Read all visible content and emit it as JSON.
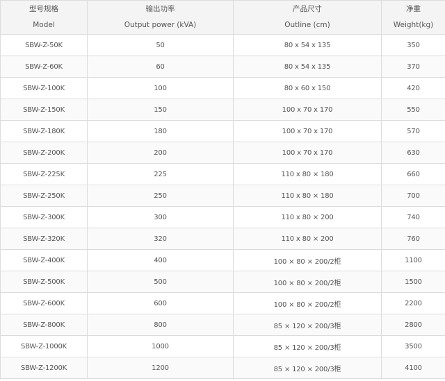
{
  "headers": [
    {
      "cn": "型号规格",
      "en": "Model"
    },
    {
      "cn": "输出功率",
      "en": "Output power (kVA)"
    },
    {
      "cn": "产品尺寸",
      "en": "Outline (cm)"
    },
    {
      "cn": "净重",
      "en": "Weight(kg)"
    }
  ],
  "rows": [
    [
      "SBW-Z-50K",
      "50",
      "80 x 54 x 135",
      "350"
    ],
    [
      "SBW-Z-60K",
      "60",
      "80 x 54 x 135",
      "370"
    ],
    [
      "SBW-Z-100K",
      "100",
      "80 x 60 x 150",
      "420"
    ],
    [
      "SBW-Z-150K",
      "150",
      "100 x 70 x 170",
      "550"
    ],
    [
      "SBW-Z-180K",
      "180",
      "100 x 70 x 170",
      "570"
    ],
    [
      "SBW-Z-200K",
      "200",
      "100 x 70 x 170",
      "630"
    ],
    [
      "SBW-Z-225K",
      "225",
      "110 x 80 × 180",
      "660"
    ],
    [
      "SBW-Z-250K",
      "250",
      "110 x 80 × 180",
      "700"
    ],
    [
      "SBW-Z-300K",
      "300",
      "110 x 80 × 200",
      "740"
    ],
    [
      "SBW-Z-320K",
      "320",
      "110 x 80 × 200",
      "760"
    ],
    [
      "SBW-Z-400K",
      "400",
      "100 × 80 × 200/2柜",
      "1100"
    ],
    [
      "SBW-Z-500K",
      "500",
      "100 × 80 × 200/2柜",
      "1500"
    ],
    [
      "SBW-Z-600K",
      "600",
      "100 × 80 × 200/2柜",
      "2200"
    ],
    [
      "SBW-Z-800K",
      "800",
      "85 × 120 × 200/3柜",
      "2800"
    ],
    [
      "SBW-Z-1000K",
      "1000",
      "85 × 120 × 200/3柜",
      "3500"
    ],
    [
      "SBW-Z-1200K",
      "1200",
      "85 × 120 × 200/3柜",
      "4100"
    ]
  ]
}
